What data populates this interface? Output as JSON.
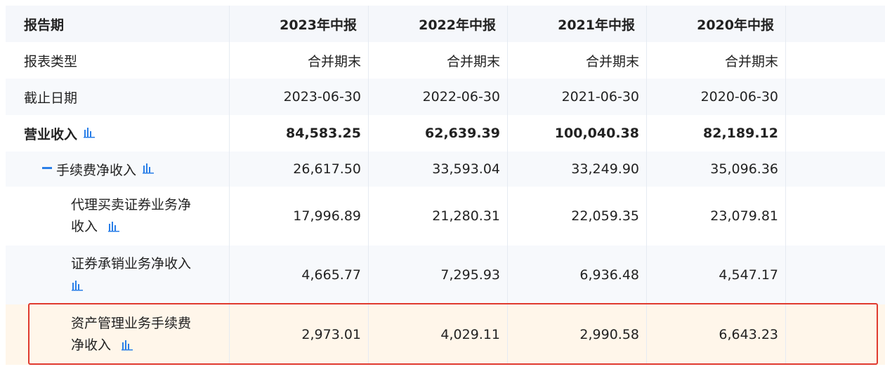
{
  "header": {
    "label": "报告期",
    "periods": [
      "2023年中报",
      "2022年中报",
      "2021年中报",
      "2020年中报"
    ]
  },
  "rows": [
    {
      "label": "报表类型",
      "values": [
        "合并期末",
        "合并期末",
        "合并期末",
        "合并期末"
      ]
    },
    {
      "label": "截止日期",
      "values": [
        "2023-06-30",
        "2022-06-30",
        "2021-06-30",
        "2020-06-30"
      ]
    },
    {
      "label": "营业收入",
      "values": [
        "84,583.25",
        "62,639.39",
        "100,040.38",
        "82,189.12"
      ]
    },
    {
      "label": "手续费净收入",
      "values": [
        "26,617.50",
        "33,593.04",
        "33,249.90",
        "35,096.36"
      ]
    },
    {
      "label_line1": "代理买卖证券业务净",
      "label_line2": "收入",
      "values": [
        "17,996.89",
        "21,280.31",
        "22,059.35",
        "23,079.81"
      ]
    },
    {
      "label_line1": "证券承销业务净收入",
      "values": [
        "4,665.77",
        "7,295.93",
        "6,936.48",
        "4,547.17"
      ]
    },
    {
      "label_line1": "资产管理业务手续费",
      "label_line2": "净收入",
      "values": [
        "2,973.01",
        "4,029.11",
        "2,990.58",
        "6,643.23"
      ]
    }
  ],
  "colors": {
    "accent": "#2a7fe8",
    "highlight_border": "#e03a2f",
    "highlight_bg": "#fff6ea",
    "header_bg": "#f5f7fb"
  },
  "icons": {
    "chart": "bar-chart-icon",
    "collapse": "minus-icon"
  }
}
